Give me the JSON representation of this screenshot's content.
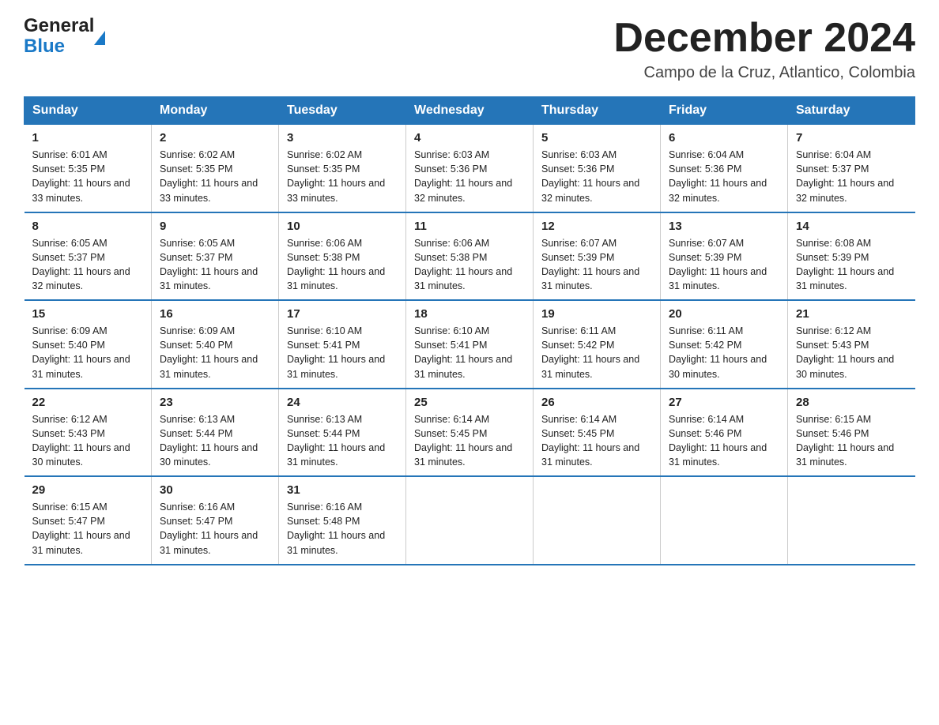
{
  "logo": {
    "general": "General",
    "blue": "Blue"
  },
  "title": "December 2024",
  "location": "Campo de la Cruz, Atlantico, Colombia",
  "days_of_week": [
    "Sunday",
    "Monday",
    "Tuesday",
    "Wednesday",
    "Thursday",
    "Friday",
    "Saturday"
  ],
  "weeks": [
    [
      {
        "day": "1",
        "sunrise": "Sunrise: 6:01 AM",
        "sunset": "Sunset: 5:35 PM",
        "daylight": "Daylight: 11 hours and 33 minutes."
      },
      {
        "day": "2",
        "sunrise": "Sunrise: 6:02 AM",
        "sunset": "Sunset: 5:35 PM",
        "daylight": "Daylight: 11 hours and 33 minutes."
      },
      {
        "day": "3",
        "sunrise": "Sunrise: 6:02 AM",
        "sunset": "Sunset: 5:35 PM",
        "daylight": "Daylight: 11 hours and 33 minutes."
      },
      {
        "day": "4",
        "sunrise": "Sunrise: 6:03 AM",
        "sunset": "Sunset: 5:36 PM",
        "daylight": "Daylight: 11 hours and 32 minutes."
      },
      {
        "day": "5",
        "sunrise": "Sunrise: 6:03 AM",
        "sunset": "Sunset: 5:36 PM",
        "daylight": "Daylight: 11 hours and 32 minutes."
      },
      {
        "day": "6",
        "sunrise": "Sunrise: 6:04 AM",
        "sunset": "Sunset: 5:36 PM",
        "daylight": "Daylight: 11 hours and 32 minutes."
      },
      {
        "day": "7",
        "sunrise": "Sunrise: 6:04 AM",
        "sunset": "Sunset: 5:37 PM",
        "daylight": "Daylight: 11 hours and 32 minutes."
      }
    ],
    [
      {
        "day": "8",
        "sunrise": "Sunrise: 6:05 AM",
        "sunset": "Sunset: 5:37 PM",
        "daylight": "Daylight: 11 hours and 32 minutes."
      },
      {
        "day": "9",
        "sunrise": "Sunrise: 6:05 AM",
        "sunset": "Sunset: 5:37 PM",
        "daylight": "Daylight: 11 hours and 31 minutes."
      },
      {
        "day": "10",
        "sunrise": "Sunrise: 6:06 AM",
        "sunset": "Sunset: 5:38 PM",
        "daylight": "Daylight: 11 hours and 31 minutes."
      },
      {
        "day": "11",
        "sunrise": "Sunrise: 6:06 AM",
        "sunset": "Sunset: 5:38 PM",
        "daylight": "Daylight: 11 hours and 31 minutes."
      },
      {
        "day": "12",
        "sunrise": "Sunrise: 6:07 AM",
        "sunset": "Sunset: 5:39 PM",
        "daylight": "Daylight: 11 hours and 31 minutes."
      },
      {
        "day": "13",
        "sunrise": "Sunrise: 6:07 AM",
        "sunset": "Sunset: 5:39 PM",
        "daylight": "Daylight: 11 hours and 31 minutes."
      },
      {
        "day": "14",
        "sunrise": "Sunrise: 6:08 AM",
        "sunset": "Sunset: 5:39 PM",
        "daylight": "Daylight: 11 hours and 31 minutes."
      }
    ],
    [
      {
        "day": "15",
        "sunrise": "Sunrise: 6:09 AM",
        "sunset": "Sunset: 5:40 PM",
        "daylight": "Daylight: 11 hours and 31 minutes."
      },
      {
        "day": "16",
        "sunrise": "Sunrise: 6:09 AM",
        "sunset": "Sunset: 5:40 PM",
        "daylight": "Daylight: 11 hours and 31 minutes."
      },
      {
        "day": "17",
        "sunrise": "Sunrise: 6:10 AM",
        "sunset": "Sunset: 5:41 PM",
        "daylight": "Daylight: 11 hours and 31 minutes."
      },
      {
        "day": "18",
        "sunrise": "Sunrise: 6:10 AM",
        "sunset": "Sunset: 5:41 PM",
        "daylight": "Daylight: 11 hours and 31 minutes."
      },
      {
        "day": "19",
        "sunrise": "Sunrise: 6:11 AM",
        "sunset": "Sunset: 5:42 PM",
        "daylight": "Daylight: 11 hours and 31 minutes."
      },
      {
        "day": "20",
        "sunrise": "Sunrise: 6:11 AM",
        "sunset": "Sunset: 5:42 PM",
        "daylight": "Daylight: 11 hours and 30 minutes."
      },
      {
        "day": "21",
        "sunrise": "Sunrise: 6:12 AM",
        "sunset": "Sunset: 5:43 PM",
        "daylight": "Daylight: 11 hours and 30 minutes."
      }
    ],
    [
      {
        "day": "22",
        "sunrise": "Sunrise: 6:12 AM",
        "sunset": "Sunset: 5:43 PM",
        "daylight": "Daylight: 11 hours and 30 minutes."
      },
      {
        "day": "23",
        "sunrise": "Sunrise: 6:13 AM",
        "sunset": "Sunset: 5:44 PM",
        "daylight": "Daylight: 11 hours and 30 minutes."
      },
      {
        "day": "24",
        "sunrise": "Sunrise: 6:13 AM",
        "sunset": "Sunset: 5:44 PM",
        "daylight": "Daylight: 11 hours and 31 minutes."
      },
      {
        "day": "25",
        "sunrise": "Sunrise: 6:14 AM",
        "sunset": "Sunset: 5:45 PM",
        "daylight": "Daylight: 11 hours and 31 minutes."
      },
      {
        "day": "26",
        "sunrise": "Sunrise: 6:14 AM",
        "sunset": "Sunset: 5:45 PM",
        "daylight": "Daylight: 11 hours and 31 minutes."
      },
      {
        "day": "27",
        "sunrise": "Sunrise: 6:14 AM",
        "sunset": "Sunset: 5:46 PM",
        "daylight": "Daylight: 11 hours and 31 minutes."
      },
      {
        "day": "28",
        "sunrise": "Sunrise: 6:15 AM",
        "sunset": "Sunset: 5:46 PM",
        "daylight": "Daylight: 11 hours and 31 minutes."
      }
    ],
    [
      {
        "day": "29",
        "sunrise": "Sunrise: 6:15 AM",
        "sunset": "Sunset: 5:47 PM",
        "daylight": "Daylight: 11 hours and 31 minutes."
      },
      {
        "day": "30",
        "sunrise": "Sunrise: 6:16 AM",
        "sunset": "Sunset: 5:47 PM",
        "daylight": "Daylight: 11 hours and 31 minutes."
      },
      {
        "day": "31",
        "sunrise": "Sunrise: 6:16 AM",
        "sunset": "Sunset: 5:48 PM",
        "daylight": "Daylight: 11 hours and 31 minutes."
      },
      {
        "day": "",
        "sunrise": "",
        "sunset": "",
        "daylight": ""
      },
      {
        "day": "",
        "sunrise": "",
        "sunset": "",
        "daylight": ""
      },
      {
        "day": "",
        "sunrise": "",
        "sunset": "",
        "daylight": ""
      },
      {
        "day": "",
        "sunrise": "",
        "sunset": "",
        "daylight": ""
      }
    ]
  ]
}
